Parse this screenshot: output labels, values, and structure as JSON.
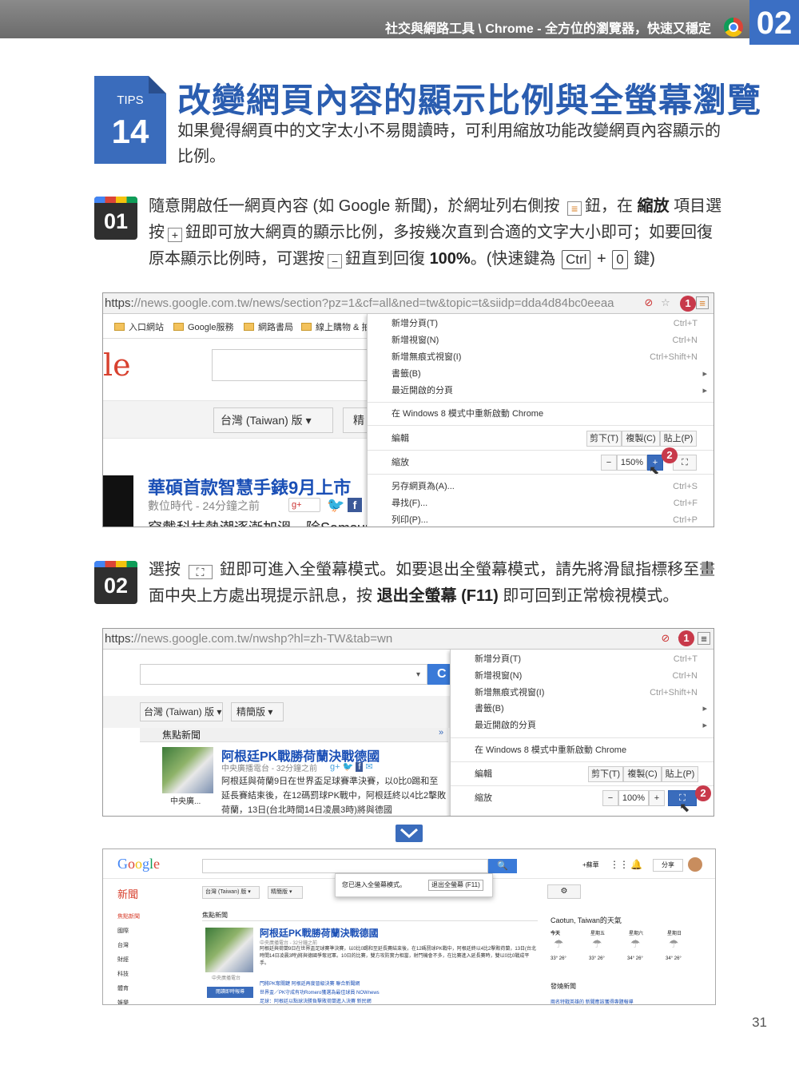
{
  "header": {
    "text": "社交與網路工具 \\ Chrome - 全方位的瀏覽器，快速又穩定",
    "chapter": "02"
  },
  "tips": {
    "label": "TIPS",
    "number": "14",
    "title": "改變網頁內容的顯示比例與全螢幕瀏覽",
    "desc": "如果覺得網頁中的文字太小不易閱讀時，可利用縮放功能改變網頁內容顯示的比例。"
  },
  "step1": {
    "num": "01",
    "t1": "隨意開啟任一網頁內容 (如 Google 新聞)，於網址列右側按",
    "t2": "鈕，在",
    "t3": "縮放",
    "t4": "項目選按",
    "t5": "鈕即可放大網頁的顯示比例，多按幾次直到合適的文字大小即可；如要回復原本顯示比例時，可選按",
    "t6": "鈕直到回復",
    "t7": "100%",
    "t8": "。(快速鍵為",
    "k1": "Ctrl",
    "plus": "+",
    "k2": "0",
    "t9": "鍵)"
  },
  "step2": {
    "num": "02",
    "t1": "選按",
    "t2": "鈕即可進入全螢幕模式。如要退出全螢幕模式，請先將滑鼠指標移至畫面中央上方處出現提示訊息，按",
    "t3": "退出全螢幕 (F11)",
    "t4": "即可回到正常檢視模式。"
  },
  "shot1": {
    "url_a": "https:",
    "url_b": "//news.google.com.tw/news/section?pz=1&cf=all&ned=tw&topic=t&siidp=dda4d84bc0eeaa",
    "bookmarks": [
      "入口網站",
      "Google服務",
      "網路書局",
      "線上購物 & 拍"
    ],
    "logo_frag": "le",
    "edition": "台灣 (Taiwan) 版 ▾",
    "tab_frag": "精",
    "headline": "華碩首款智慧手錶9月上市",
    "source": "數位時代 - 24分鐘之前",
    "bottom": "穿戴科技熱潮逐漸加溫，除Samsun",
    "menu": [
      {
        "label": "新增分頁(T)",
        "sc": "Ctrl+T"
      },
      {
        "label": "新增視窗(N)",
        "sc": "Ctrl+N"
      },
      {
        "label": "新增無痕式視窗(I)",
        "sc": "Ctrl+Shift+N"
      },
      {
        "label": "書籤(B)",
        "sc": "▸"
      },
      {
        "label": "最近開啟的分頁",
        "sc": "▸"
      },
      {
        "label": "在 Windows 8 模式中重新啟動 Chrome",
        "sc": ""
      },
      {
        "label": "編輯",
        "sc": ""
      },
      {
        "label": "縮放",
        "sc": ""
      },
      {
        "label": "另存網頁為(A)...",
        "sc": "Ctrl+S"
      },
      {
        "label": "尋找(F)...",
        "sc": "Ctrl+F"
      },
      {
        "label": "列印(P)...",
        "sc": "Ctrl+P"
      }
    ],
    "edit_btns": [
      "剪下(T)",
      "複製(C)",
      "貼上(P)"
    ],
    "zoom": {
      "minus": "−",
      "value": "150%",
      "plus": "+"
    },
    "badge1": "1",
    "badge2": "2"
  },
  "shot2": {
    "url_a": "https:",
    "url_b": "//news.google.com.tw/nwshp?hl=zh-TW&tab=wn",
    "edition": "台灣 (Taiwan) 版 ▾",
    "tab2": "精簡版 ▾",
    "section": "焦點新聞",
    "go": "C",
    "headline": "阿根廷PK戰勝荷蘭決戰德國",
    "source": "中央廣播電台 - 32分鐘之前",
    "body": "阿根廷與荷蘭9日在世界盃足球賽準決賽，以0比0踢和至延長賽結束後，在12碼罰球PK戰中，阿根廷終以4比2擊敗荷蘭，13日(台北時間14日凌晨3時)將與德國",
    "thumbcap": "中央廣...",
    "menu": [
      {
        "label": "新增分頁(T)",
        "sc": "Ctrl+T"
      },
      {
        "label": "新增視窗(N)",
        "sc": "Ctrl+N"
      },
      {
        "label": "新增無痕式視窗(I)",
        "sc": "Ctrl+Shift+N"
      },
      {
        "label": "書籤(B)",
        "sc": "▸"
      },
      {
        "label": "最近開啟的分頁",
        "sc": "▸"
      },
      {
        "label": "在 Windows 8 模式中重新啟動 Chrome",
        "sc": ""
      },
      {
        "label": "編輯",
        "sc": ""
      },
      {
        "label": "縮放",
        "sc": ""
      }
    ],
    "edit_btns": [
      "剪下(T)",
      "複製(C)",
      "貼上(P)"
    ],
    "zoom": {
      "minus": "−",
      "value": "100%",
      "plus": "+"
    },
    "badge1": "1",
    "badge2": "2"
  },
  "shot3": {
    "logo": "Google",
    "section_title": "新聞",
    "edition": "台灣 (Taiwan) 版 ▾",
    "tab2": "精簡版 ▾",
    "msg": "您已進入全螢幕模式。",
    "exit": "退出全螢幕 (F11)",
    "plus_me": "+蘇華",
    "share": "分享",
    "nav": [
      "焦點新聞",
      "國際",
      "台灣",
      "財經",
      "科技",
      "體育",
      "娛樂"
    ],
    "section": "焦點新聞",
    "headline": "阿根廷PK戰勝荷蘭決戰德國",
    "source": "中央廣播電台 - 32分鐘之前",
    "body": "阿根廷與荷蘭9日在世界盃足球賽準決賽，以0比0踢和至延長賽結束後，在12碼罰球PK戰中，阿根廷終以4比2擊敗荷蘭，13日(台北時間14日凌晨3時)將與德國爭奪冠軍。10日的比賽，雙方攻防實力相當，射門機會不多，在比賽進入延長賽時，雙以0比0戰成平手。",
    "rel1": "門將PK奪關鍵 阿根廷再度晉級決賽 聯合新聞網",
    "rel2": "世界盃／PK守成有功Romero獲選為最佳球員 NOWnews",
    "rel3": "足球：阿根廷以點球決勝負擊敗荷蘭進入決賽 新民網",
    "thumbcap": "中央廣播電台",
    "btn": "閱讀即時報導",
    "weather": {
      "title": "Caotun, Taiwan的天氣",
      "days": [
        "今天",
        "星期五",
        "星期六",
        "星期日"
      ],
      "temps": [
        "33° 26°",
        "33° 26°",
        "34° 26°",
        "34° 26°"
      ]
    },
    "recent": "發燒新聞",
    "recent_item": "兩名特戰英雄的 新聞應該獲得專題報導"
  },
  "page_number": "31"
}
